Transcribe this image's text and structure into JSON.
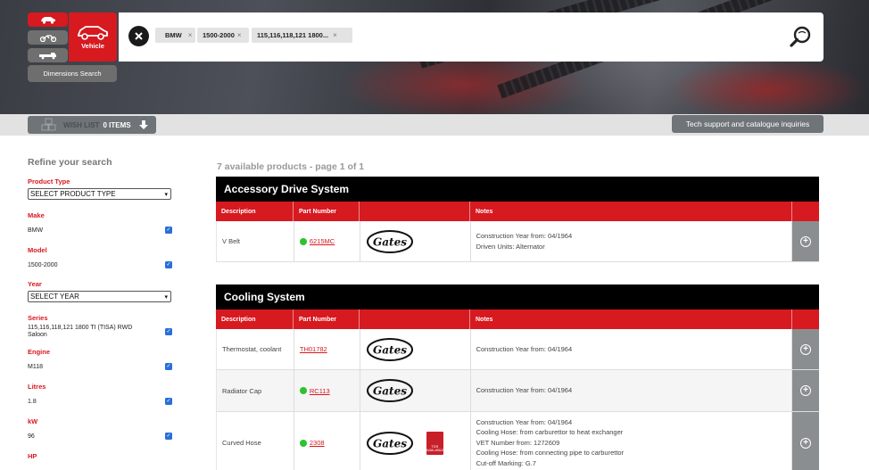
{
  "search_modes": {
    "vehicle_label": "Vehicle",
    "dimensions_label": "Dimensions Search"
  },
  "search": {
    "chips": [
      "BMW",
      "1500-2000",
      "115,116,118,121 1800..."
    ]
  },
  "wishlist": {
    "label": "WISH LIST",
    "count": "0 ITEMS"
  },
  "tech_support_label": "Tech support and catalogue inquiries",
  "sidebar": {
    "title": "Refine your search",
    "product_type": {
      "label": "Product Type",
      "value": "SELECT PRODUCT TYPE"
    },
    "make": {
      "label": "Make",
      "value": "BMW"
    },
    "model": {
      "label": "Model",
      "value": "1500-2000"
    },
    "year": {
      "label": "Year",
      "value": "SELECT YEAR"
    },
    "series": {
      "label": "Series",
      "value_line1": "115,116,118,121 1800 TI (TISA) RWD",
      "value_line2": "Saloon"
    },
    "engine": {
      "label": "Engine",
      "value": "M118"
    },
    "litres": {
      "label": "Litres",
      "value": "1.8"
    },
    "kw": {
      "label": "kW",
      "value": "96"
    },
    "hp": {
      "label": "HP"
    }
  },
  "results": {
    "summary": "7 available products - page 1 of 1",
    "headers": {
      "description": "Description",
      "part_number": "Part Number",
      "notes": "Notes"
    },
    "categories": [
      {
        "title": "Accessory Drive System",
        "rows": [
          {
            "description": "V Belt",
            "part_number": "6215MC",
            "in_stock": true,
            "notes": [
              "Construction Year from: 04/1964",
              "Driven Units: Alternator"
            ]
          }
        ]
      },
      {
        "title": "Cooling System",
        "rows": [
          {
            "description": "Thermostat, coolant",
            "part_number": "TH01782",
            "in_stock": false,
            "notes": [
              "Construction Year from: 04/1964"
            ]
          },
          {
            "description": "Radiator Cap",
            "part_number": "RC113",
            "in_stock": true,
            "notes": [
              "Construction Year from: 04/1964"
            ]
          },
          {
            "description": "Curved Hose",
            "part_number": "2308",
            "in_stock": true,
            "notes": [
              "Construction Year from: 04/1964",
              "Cooling Hose: from carburettor to heat exchanger",
              "VET Number from: 1272609",
              "Cooling Hose: from connecting pipe to carburettor",
              "Cut-off Marking: G.7"
            ]
          }
        ]
      }
    ]
  },
  "brand": {
    "logo_text": "Gates",
    "tds_badge_text": "TDS AVAILABLE"
  },
  "colors": {
    "accent": "#d71920",
    "header_black": "#000000",
    "stock_green": "#2ec22e",
    "button_grey": "#6e7478"
  }
}
